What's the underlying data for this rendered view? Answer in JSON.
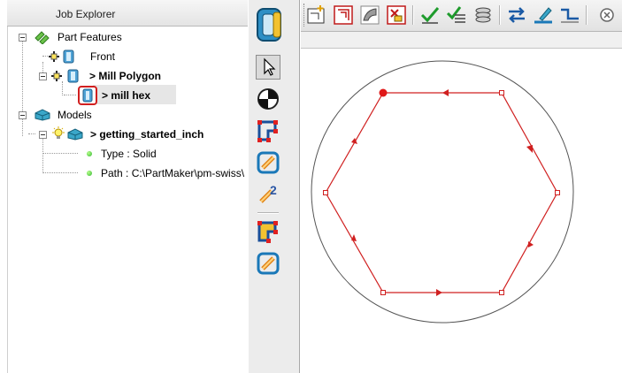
{
  "explorer": {
    "title": "Job Explorer",
    "items": [
      {
        "label": "Part Features",
        "bold": false
      },
      {
        "label": "Front",
        "bold": false
      },
      {
        "label": "> Mill Polygon",
        "bold": true
      },
      {
        "label": "> mill hex",
        "bold": true,
        "selected": true
      },
      {
        "label": "Models",
        "bold": false
      },
      {
        "label": "> getting_started_inch",
        "bold": true
      },
      {
        "label": "Type : Solid",
        "bold": false
      },
      {
        "label": "Path : C:\\PartMaker\\pm-swiss\\",
        "bold": false
      }
    ]
  },
  "strip": {
    "buttons": [
      "feature-icon",
      "select-arrow-icon",
      "center-point-icon",
      "polygon-path-icon",
      "link-path-icon",
      "chain-link-icon",
      "polygon-path-alt-icon",
      "link-path-alt-icon"
    ]
  },
  "toolbar": {
    "buttons": [
      "add-element-icon",
      "offset-icon",
      "surface-icon",
      "delete-icon",
      "check-icon",
      "check-list-icon",
      "stack-icon",
      "swap-direction-icon",
      "edit-level-icon",
      "step-icon",
      "zoom-icon"
    ]
  },
  "colors": {
    "path": "#d02020",
    "circle": "#555555",
    "highlight": "#e6e6e6"
  },
  "geometry": {
    "shape": "hexagon",
    "boundary": "circle"
  }
}
